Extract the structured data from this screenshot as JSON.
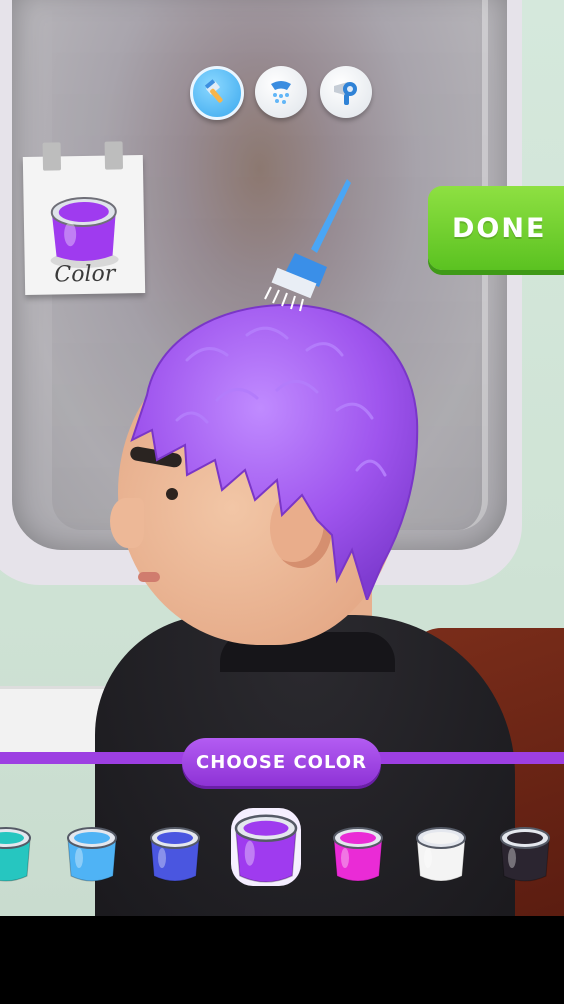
{
  "toolbar": {
    "tools": [
      {
        "name": "brush",
        "active": true
      },
      {
        "name": "shower",
        "active": false
      },
      {
        "name": "hair-dryer",
        "active": false
      }
    ]
  },
  "note_card": {
    "label": "Color",
    "color": "#9f3bef"
  },
  "done_button": {
    "label": "DONE"
  },
  "color_picker": {
    "label": "CHOOSE COLOR",
    "selected_index": 3,
    "colors": [
      "#26c6c0",
      "#4fb3f5",
      "#4a56e0",
      "#9f3bef",
      "#ea2bd6",
      "#f4f4f4",
      "#2b2530"
    ]
  },
  "hair_color": "#a35cf0"
}
